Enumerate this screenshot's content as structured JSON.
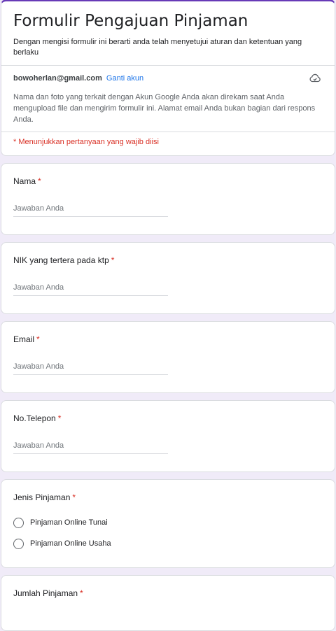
{
  "form": {
    "title": "Formulir Pengajuan Pinjaman",
    "description": "Dengan mengisi formulir ini berarti anda telah menyetujui aturan dan ketentuan yang berlaku",
    "account_email": "bowoherlan@gmail.com",
    "switch_account": "Ganti akun",
    "privacy_note": "Nama dan foto yang terkait dengan Akun Google Anda akan direkam saat Anda mengupload file dan mengirim formulir ini. Alamat email Anda bukan bagian dari respons Anda.",
    "required_note": "* Menunjukkan pertanyaan yang wajib diisi"
  },
  "questions": [
    {
      "label": "Nama",
      "required": "*",
      "placeholder": "Jawaban Anda"
    },
    {
      "label": "NIK yang tertera pada ktp",
      "required": "*",
      "placeholder": "Jawaban Anda"
    },
    {
      "label": "Email",
      "required": "*",
      "placeholder": "Jawaban Anda"
    },
    {
      "label": "No.Telepon",
      "required": "*",
      "placeholder": "Jawaban Anda"
    },
    {
      "label": "Jenis Pinjaman",
      "required": "*",
      "options": [
        "Pinjaman Online Tunai",
        "Pinjaman Online Usaha"
      ]
    },
    {
      "label": "Jumlah Pinjaman",
      "required": "*"
    }
  ],
  "colors": {
    "accent": "#673ab7",
    "background": "#f0ebf8",
    "required": "#d93025",
    "link": "#1a73e8"
  },
  "icons": {
    "save_status": "cloud-icon"
  }
}
